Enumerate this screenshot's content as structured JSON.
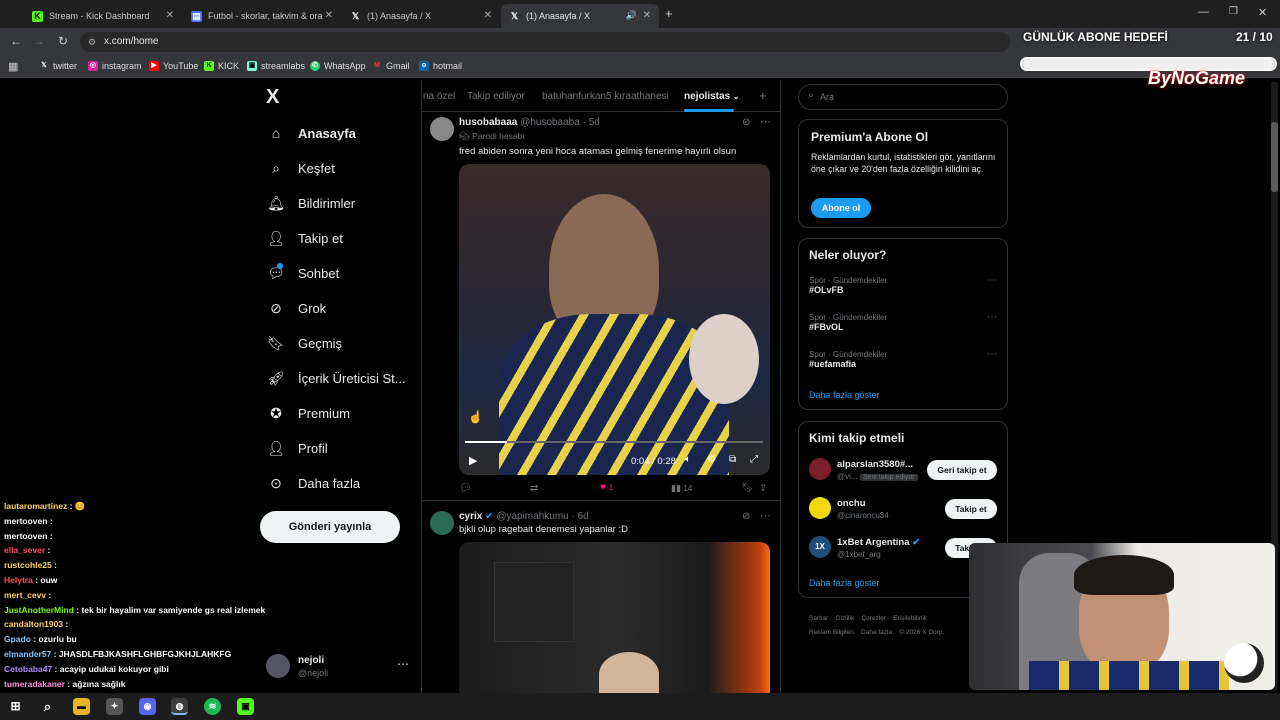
{
  "browser": {
    "tabs": [
      {
        "title": "Stream - Kick Dashboard"
      },
      {
        "title": "Futbol - skorlar, takvim & oranla"
      },
      {
        "title": "(1) Anasayfa / X"
      },
      {
        "title": "(1) Anasayfa / X"
      }
    ],
    "url": "x.com/home",
    "bookmarks": [
      "twitter",
      "instagram",
      "YouTube",
      "KICK",
      "streamlabs",
      "WhatsApp",
      "Gmail",
      "hotmail"
    ]
  },
  "overlay": {
    "goal_title": "GÜNLÜK ABONE HEDEFİ",
    "goal_count": "21 / 10",
    "brand": "ByNoGame"
  },
  "sidebar": {
    "logo": "X",
    "items": [
      {
        "label": "Anasayfa",
        "icon": "home-icon"
      },
      {
        "label": "Keşfet",
        "icon": "search-icon"
      },
      {
        "label": "Bildirimler",
        "icon": "bell-icon"
      },
      {
        "label": "Takip et",
        "icon": "person-add-icon"
      },
      {
        "label": "Sohbet",
        "icon": "chat-icon"
      },
      {
        "label": "Grok",
        "icon": "grok-icon"
      },
      {
        "label": "Geçmiş",
        "icon": "bookmark-icon"
      },
      {
        "label": "İçerik Üreticisi St...",
        "icon": "rocket-icon"
      },
      {
        "label": "Premium",
        "icon": "verified-icon"
      },
      {
        "label": "Profil",
        "icon": "profile-icon"
      },
      {
        "label": "Daha fazla",
        "icon": "more-circle-icon"
      }
    ],
    "post_button": "Gönderi yayınla",
    "account": {
      "name": "nejoli",
      "handle": "@nejoli"
    }
  },
  "timeline": {
    "tabs": [
      "na özel",
      "Takip ediliyor",
      "batuhanfurkan5 kıraathanesi",
      "nejolistas"
    ],
    "tweets": [
      {
        "name": "husobabaaa",
        "handle": "@husobaaba",
        "time": "5d",
        "badge": "Parodi hesabı",
        "text": "fred abiden sonra yeni hoca ataması gelmiş fenerime hayırlı olsun",
        "video_time": "0:04 / 0:28",
        "likes": "1",
        "views": "14"
      },
      {
        "name": "cyrix",
        "handle": "@yapimahkumu",
        "time": "6d",
        "text": "bjkli olup ragebait denemesi yapanlar :D"
      }
    ]
  },
  "right": {
    "search_placeholder": "Ara",
    "premium": {
      "title": "Premium'a Abone Ol",
      "body": "Reklamlardan kurtul, istatistikleri gör, yanıtlarını öne çıkar ve 20'den fazla özelliğin kilidini aç.",
      "button": "Abone ol"
    },
    "trends_title": "Neler oluyor?",
    "trends": [
      {
        "category": "Spor · Gündemdekiler",
        "tag": "#OLvFB"
      },
      {
        "category": "Spor · Gündemdekiler",
        "tag": "#FBvOL"
      },
      {
        "category": "Spor · Gündemdekiler",
        "tag": "#uefamafia"
      }
    ],
    "trends_more": "Daha fazla göster",
    "who_title": "Kimi takip etmeli",
    "who": [
      {
        "name": "alparslan3580#...",
        "handle": "@vi...",
        "note": "Seni takip ediyor",
        "button": "Geri takip et"
      },
      {
        "name": "onchu",
        "handle": "@cinaroncu34",
        "button": "Takip et"
      },
      {
        "name": "1xBet Argentina",
        "handle": "@1xbet_arg",
        "button": "Takip et"
      }
    ],
    "who_more": "Daha fazla göster",
    "footer": [
      "Şartlar",
      "Gizlilik",
      "Çerezler",
      "Erişilebilirlik",
      "Reklam Bilgileri",
      "Daha fazla",
      "© 2026 X Corp."
    ]
  },
  "chat": [
    {
      "user": "lautaromartinez",
      "msg": "😊",
      "color": "#ffd166"
    },
    {
      "user": "mertooven",
      "msg": "",
      "color": "#fff"
    },
    {
      "user": "mertooven",
      "msg": "",
      "color": "#fff"
    },
    {
      "user": "ella_sever",
      "msg": "",
      "color": "#ff4d6d"
    },
    {
      "user": "rustcohle25",
      "msg": "",
      "color": "#ffd166"
    },
    {
      "user": "Helytra",
      "msg": "ouw",
      "color": "#ff4d4d"
    },
    {
      "user": "mert_cevv",
      "msg": "",
      "color": "#ffd166"
    },
    {
      "user": "JustAnotherMind",
      "msg": "tek bir hayalim var samiyende gs real izlemek",
      "color": "#7CFC00"
    },
    {
      "user": "candalton1903",
      "msg": "",
      "color": "#ffd166"
    },
    {
      "user": "Gpado",
      "msg": "ozurlu bu",
      "color": "#7ec8ff"
    },
    {
      "user": "elmander57",
      "msg": "JHASDLFBJKASHFLGHBFGJKHJLAHKFG",
      "color": "#7ec8ff"
    },
    {
      "user": "Cetobaba47",
      "msg": "acayip udukai kokuyor gibi",
      "color": "#b388ff"
    },
    {
      "user": "tumeradakaner",
      "msg": "ağzına sağlık",
      "color": "#ff8fd6"
    }
  ],
  "colors": {
    "accent": "#1d9bf0",
    "bg": "#000000",
    "border": "#2f3336",
    "muted": "#71767b"
  }
}
